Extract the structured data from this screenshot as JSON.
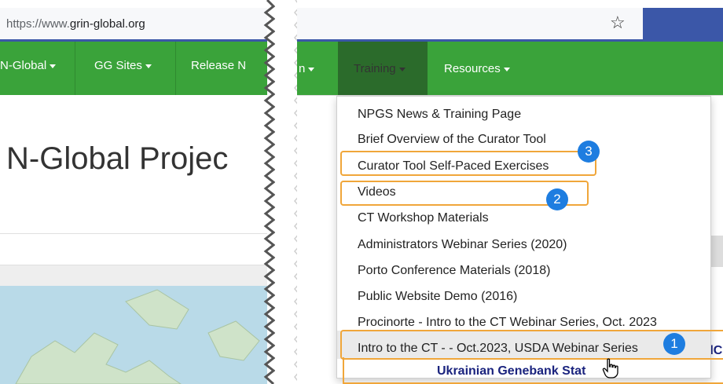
{
  "left": {
    "url_prefix": "https://www.",
    "url_domain": "grin-global.org",
    "nav": [
      {
        "label": "N-Global"
      },
      {
        "label": "GG Sites"
      },
      {
        "label": "Release N"
      }
    ],
    "hero_title": "N-Global Projec"
  },
  "right": {
    "nav": [
      {
        "label": "n"
      },
      {
        "label": "Training"
      },
      {
        "label": "Resources"
      }
    ],
    "menu": [
      "NPGS News & Training Page",
      "Brief Overview of the Curator Tool",
      "Curator Tool Self-Paced Exercises",
      "Videos",
      "CT Workshop Materials",
      "Administrators Webinar Series (2020)",
      "Porto Conference Materials (2018)",
      "Public Website Demo (2016)",
      "Procinorte - Intro to the CT Webinar Series, Oct. 2023",
      "Intro to the CT - - Oct.2023, USDA Webinar Series"
    ],
    "badges": [
      "1",
      "2",
      "3"
    ],
    "bottom_link": "Ukrainian Genebank Stat",
    "side_fragment": "dC"
  },
  "colors": {
    "nav_green": "#3aa33a",
    "nav_active": "#2b6b2b",
    "badge_blue": "#1e7de0",
    "highlight_orange": "#f0a63a",
    "bar_blue": "#3b57a8"
  }
}
